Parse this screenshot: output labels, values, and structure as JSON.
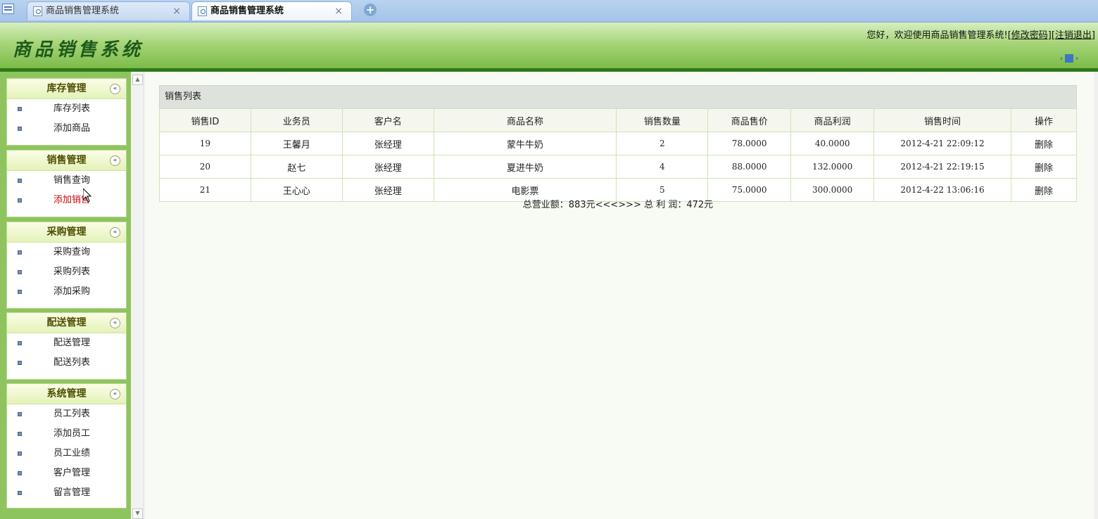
{
  "browser": {
    "tabs": [
      {
        "label": "商品销售管理系统",
        "close": "×",
        "active": false
      },
      {
        "label": "商品销售管理系统",
        "close": "×",
        "active": true
      }
    ],
    "new_tab": "+"
  },
  "header": {
    "logo": "商品销售系统",
    "welcome": "您好，欢迎使用商品销售管理系统!",
    "change_password": "[修改密码]",
    "logout": "[注销退出]",
    "mini_nav_left": "‹",
    "mini_nav_right": "›"
  },
  "sidebar": {
    "sections": [
      {
        "title": "库存管理",
        "items": [
          "库存列表",
          "添加商品"
        ]
      },
      {
        "title": "销售管理",
        "items": [
          "销售查询",
          "添加销售"
        ]
      },
      {
        "title": "采购管理",
        "items": [
          "采购查询",
          "采购列表",
          "添加采购"
        ]
      },
      {
        "title": "配送管理",
        "items": [
          "配送管理",
          "配送列表"
        ]
      },
      {
        "title": "系统管理",
        "items": [
          "员工列表",
          "添加员工",
          "员工业绩",
          "客户管理",
          "留言管理"
        ]
      }
    ],
    "collapse_glyph": "«"
  },
  "main": {
    "list_title": "销售列表",
    "columns": [
      "销售ID",
      "业务员",
      "客户名",
      "商品名称",
      "销售数量",
      "商品售价",
      "商品利润",
      "销售时间",
      "操作"
    ],
    "rows": [
      [
        "19",
        "王馨月",
        "张经理",
        "蒙牛牛奶",
        "2",
        "78.0000",
        "40.0000",
        "2012-4-21 22:09:12",
        "删除"
      ],
      [
        "20",
        "赵七",
        "张经理",
        "夏进牛奶",
        "4",
        "88.0000",
        "132.0000",
        "2012-4-21 22:19:15",
        "删除"
      ],
      [
        "21",
        "王心心",
        "张经理",
        "电影票",
        "5",
        "75.0000",
        "300.0000",
        "2012-4-22 13:06:16",
        "删除"
      ]
    ],
    "summary": "总营业额：883元<<<>>> 总 利 润：472元"
  }
}
